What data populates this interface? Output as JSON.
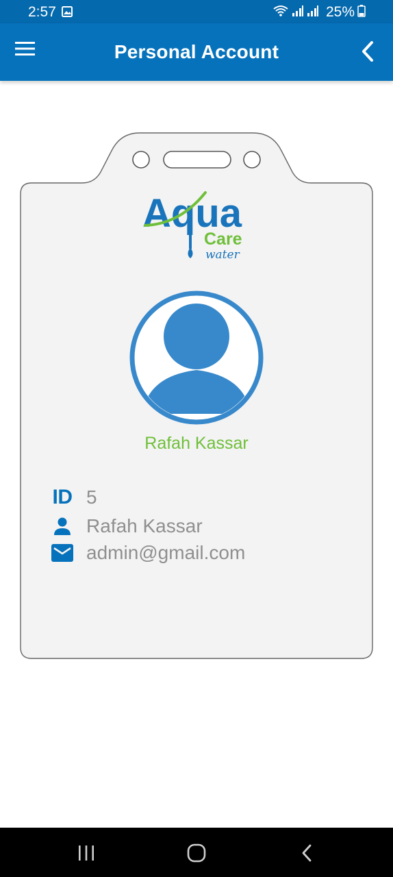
{
  "status_bar": {
    "time": "2:57",
    "battery_percent": "25%",
    "icons": [
      "image-icon",
      "wifi-icon",
      "signal-icon",
      "signal-icon",
      "battery-icon"
    ]
  },
  "app_bar": {
    "title": "Personal Account",
    "menu_icon": "hamburger-menu-icon",
    "back_icon": "chevron-left-icon",
    "background_color": "#0672bb"
  },
  "logo": {
    "word_main": "Aqua",
    "word_sub": "Care",
    "word_tag": "water"
  },
  "profile": {
    "name": "Rafah Kassar"
  },
  "details": {
    "id_label": "ID",
    "id_value": "5",
    "name_value": "Rafah Kassar",
    "email_value": "admin@gmail.com"
  },
  "colors": {
    "primary_blue": "#0672bb",
    "avatar_blue": "#3889cb",
    "accent_green": "#6fbf3a",
    "card_fill": "#f3f3f3",
    "muted_text": "#8f8f8f"
  },
  "nav_bar": {
    "icons": [
      "recent-apps-icon",
      "home-icon",
      "back-icon"
    ]
  }
}
